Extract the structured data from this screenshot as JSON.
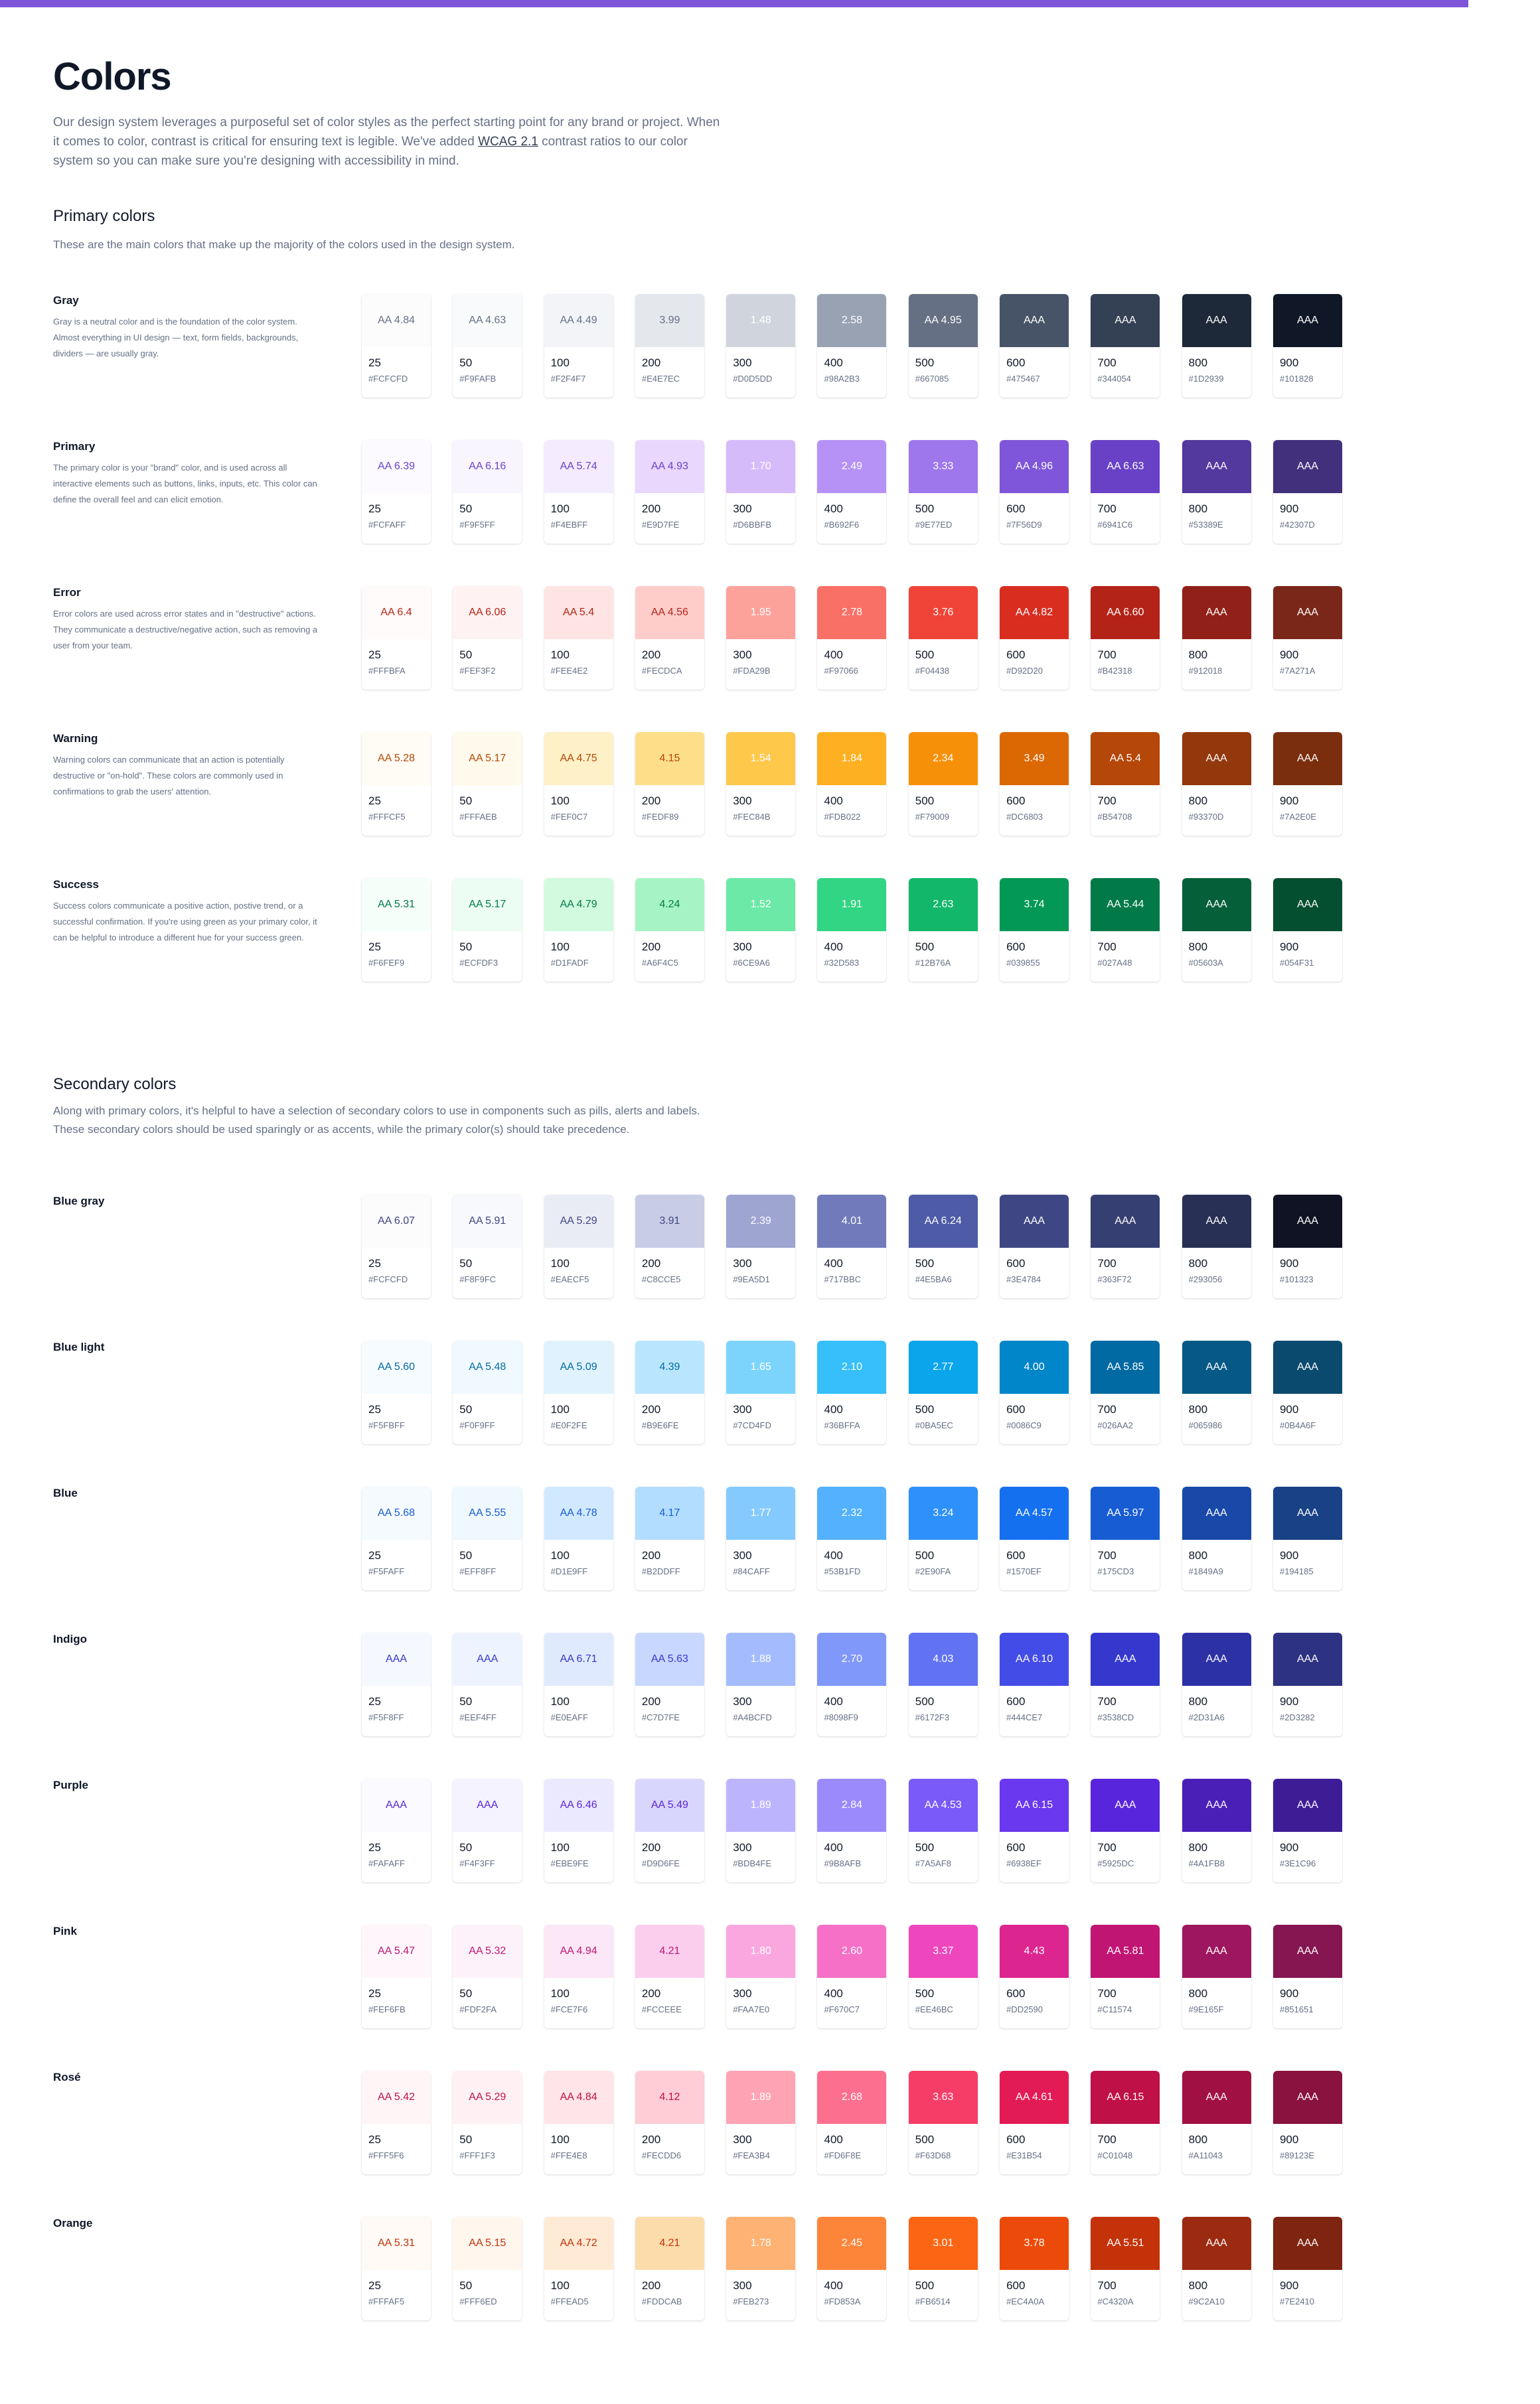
{
  "accent": "#7F56D9",
  "title": "Colors",
  "intro": {
    "text_before": "Our design system leverages a purposeful set of color styles as the perfect starting point for any brand or project. When it comes to color, contrast is critical for ensuring text is legible. We've added ",
    "link": "WCAG 2.1",
    "text_after": " contrast ratios to our color system so you can make sure you're designing with accessibility in mind."
  },
  "primary_section": {
    "title": "Primary colors",
    "description": "These are the main colors that make up the majority of the colors used in the design system."
  },
  "secondary_section": {
    "title": "Secondary colors",
    "description": "Along with primary colors, it's helpful to have a selection of secondary colors to use in components such as pills, alerts and labels. These secondary colors should be used sparingly or as accents, while the primary color(s) should take precedence."
  },
  "steps": [
    "25",
    "50",
    "100",
    "200",
    "300",
    "400",
    "500",
    "600",
    "700",
    "800",
    "900"
  ],
  "primary_palettes": [
    {
      "name": "Gray",
      "description": "Gray is a neutral color and is the foundation of the color system. Almost everything in UI design — text, form fields, backgrounds, dividers — are usually gray.",
      "hex": [
        "#FCFCFD",
        "#F9FAFB",
        "#F2F4F7",
        "#E4E7EC",
        "#D0D5DD",
        "#98A2B3",
        "#667085",
        "#475467",
        "#344054",
        "#1D2939",
        "#101828"
      ],
      "contrast": [
        "AA 4.84",
        "AA 4.63",
        "AA 4.49",
        "3.99",
        "1.48",
        "2.58",
        "AA 4.95",
        "AAA",
        "AAA",
        "AAA",
        "AAA"
      ],
      "label_color": [
        "#667085",
        "#667085",
        "#667085",
        "#667085",
        "#FFFFFF",
        "#FFFFFF",
        "#FFFFFF",
        "#FFFFFF",
        "#FFFFFF",
        "#FFFFFF",
        "#FFFFFF"
      ]
    },
    {
      "name": "Primary",
      "description": "The primary color is your \"brand\" color, and is used across all interactive elements such as buttons, links, inputs, etc. This color can define the overall feel and can elicit emotion.",
      "hex": [
        "#FCFAFF",
        "#F9F5FF",
        "#F4EBFF",
        "#E9D7FE",
        "#D6BBFB",
        "#B692F6",
        "#9E77ED",
        "#7F56D9",
        "#6941C6",
        "#53389E",
        "#42307D"
      ],
      "contrast": [
        "AA 6.39",
        "AA 6.16",
        "AA 5.74",
        "AA 4.93",
        "1.70",
        "2.49",
        "3.33",
        "AA 4.96",
        "AA 6.63",
        "AAA",
        "AAA"
      ],
      "label_color": [
        "#6941C6",
        "#6941C6",
        "#6941C6",
        "#6941C6",
        "#FFFFFF",
        "#FFFFFF",
        "#FFFFFF",
        "#FFFFFF",
        "#FFFFFF",
        "#FFFFFF",
        "#FFFFFF"
      ]
    },
    {
      "name": "Error",
      "description": "Error colors are used across error states and in \"destructive\" actions. They communicate a destructive/negative action, such as removing a user from your team.",
      "hex": [
        "#FFFBFA",
        "#FEF3F2",
        "#FEE4E2",
        "#FECDCA",
        "#FDA29B",
        "#F97066",
        "#F04438",
        "#D92D20",
        "#B42318",
        "#912018",
        "#7A271A"
      ],
      "contrast": [
        "AA 6.4",
        "AA 6.06",
        "AA 5.4",
        "AA 4.56",
        "1.95",
        "2.78",
        "3.76",
        "AA 4.82",
        "AA 6.60",
        "AAA",
        "AAA"
      ],
      "label_color": [
        "#B42318",
        "#B42318",
        "#B42318",
        "#B42318",
        "#FFFFFF",
        "#FFFFFF",
        "#FFFFFF",
        "#FFFFFF",
        "#FFFFFF",
        "#FFFFFF",
        "#FFFFFF"
      ]
    },
    {
      "name": "Warning",
      "description": "Warning colors can communicate that an action is potentially destructive or \"on-hold\". These colors are commonly used in confirmations to grab the users' attention.",
      "hex": [
        "#FFFCF5",
        "#FFFAEB",
        "#FEF0C7",
        "#FEDF89",
        "#FEC84B",
        "#FDB022",
        "#F79009",
        "#DC6803",
        "#B54708",
        "#93370D",
        "#7A2E0E"
      ],
      "contrast": [
        "AA 5.28",
        "AA 5.17",
        "AA 4.75",
        "4.15",
        "1.54",
        "1.84",
        "2.34",
        "3.49",
        "AA 5.4",
        "AAA",
        "AAA"
      ],
      "label_color": [
        "#B54708",
        "#B54708",
        "#B54708",
        "#B54708",
        "#FFFFFF",
        "#FFFFFF",
        "#FFFFFF",
        "#FFFFFF",
        "#FFFFFF",
        "#FFFFFF",
        "#FFFFFF"
      ]
    },
    {
      "name": "Success",
      "description": "Success colors communicate a positive action, postive trend, or a successful confirmation. If you're using green as your primary color, it can be helpful to introduce a different hue for your success green.",
      "hex": [
        "#F6FEF9",
        "#ECFDF3",
        "#D1FADF",
        "#A6F4C5",
        "#6CE9A6",
        "#32D583",
        "#12B76A",
        "#039855",
        "#027A48",
        "#05603A",
        "#054F31"
      ],
      "contrast": [
        "AA 5.31",
        "AA 5.17",
        "AA 4.79",
        "4.24",
        "1.52",
        "1.91",
        "2.63",
        "3.74",
        "AA 5.44",
        "AAA",
        "AAA"
      ],
      "label_color": [
        "#027A48",
        "#027A48",
        "#027A48",
        "#027A48",
        "#FFFFFF",
        "#FFFFFF",
        "#FFFFFF",
        "#FFFFFF",
        "#FFFFFF",
        "#FFFFFF",
        "#FFFFFF"
      ]
    }
  ],
  "secondary_palettes": [
    {
      "name": "Blue gray",
      "description": "",
      "hex": [
        "#FCFCFD",
        "#F8F9FC",
        "#EAECF5",
        "#C8CCE5",
        "#9EA5D1",
        "#717BBC",
        "#4E5BA6",
        "#3E4784",
        "#363F72",
        "#293056",
        "#101323"
      ],
      "contrast": [
        "AA 6.07",
        "AA 5.91",
        "AA 5.29",
        "3.91",
        "2.39",
        "4.01",
        "AA 6.24",
        "AAA",
        "AAA",
        "AAA",
        "AAA"
      ],
      "label_color": [
        "#3E4784",
        "#3E4784",
        "#3E4784",
        "#3E4784",
        "#FFFFFF",
        "#FFFFFF",
        "#FFFFFF",
        "#FFFFFF",
        "#FFFFFF",
        "#FFFFFF",
        "#FFFFFF"
      ]
    },
    {
      "name": "Blue light",
      "description": "",
      "hex": [
        "#F5FBFF",
        "#F0F9FF",
        "#E0F2FE",
        "#B9E6FE",
        "#7CD4FD",
        "#36BFFA",
        "#0BA5EC",
        "#0086C9",
        "#026AA2",
        "#065986",
        "#0B4A6F"
      ],
      "contrast": [
        "AA 5.60",
        "AA 5.48",
        "AA 5.09",
        "4.39",
        "1.65",
        "2.10",
        "2.77",
        "4.00",
        "AA 5.85",
        "AAA",
        "AAA"
      ],
      "label_color": [
        "#026AA2",
        "#026AA2",
        "#026AA2",
        "#026AA2",
        "#FFFFFF",
        "#FFFFFF",
        "#FFFFFF",
        "#FFFFFF",
        "#FFFFFF",
        "#FFFFFF",
        "#FFFFFF"
      ]
    },
    {
      "name": "Blue",
      "description": "",
      "hex": [
        "#F5FAFF",
        "#EFF8FF",
        "#D1E9FF",
        "#B2DDFF",
        "#84CAFF",
        "#53B1FD",
        "#2E90FA",
        "#1570EF",
        "#175CD3",
        "#1849A9",
        "#194185"
      ],
      "contrast": [
        "AA 5.68",
        "AA 5.55",
        "AA 4.78",
        "4.17",
        "1.77",
        "2.32",
        "3.24",
        "AA 4.57",
        "AA 5.97",
        "AAA",
        "AAA"
      ],
      "label_color": [
        "#175CD3",
        "#175CD3",
        "#175CD3",
        "#175CD3",
        "#FFFFFF",
        "#FFFFFF",
        "#FFFFFF",
        "#FFFFFF",
        "#FFFFFF",
        "#FFFFFF",
        "#FFFFFF"
      ]
    },
    {
      "name": "Indigo",
      "description": "",
      "hex": [
        "#F5F8FF",
        "#EEF4FF",
        "#E0EAFF",
        "#C7D7FE",
        "#A4BCFD",
        "#8098F9",
        "#6172F3",
        "#444CE7",
        "#3538CD",
        "#2D31A6",
        "#2D3282"
      ],
      "contrast": [
        "AAA",
        "AAA",
        "AA 6.71",
        "AA 5.63",
        "1.88",
        "2.70",
        "4.03",
        "AA 6.10",
        "AAA",
        "AAA",
        "AAA"
      ],
      "label_color": [
        "#3538CD",
        "#3538CD",
        "#3538CD",
        "#3538CD",
        "#FFFFFF",
        "#FFFFFF",
        "#FFFFFF",
        "#FFFFFF",
        "#FFFFFF",
        "#FFFFFF",
        "#FFFFFF"
      ]
    },
    {
      "name": "Purple",
      "description": "",
      "hex": [
        "#FAFAFF",
        "#F4F3FF",
        "#EBE9FE",
        "#D9D6FE",
        "#BDB4FE",
        "#9B8AFB",
        "#7A5AF8",
        "#6938EF",
        "#5925DC",
        "#4A1FB8",
        "#3E1C96"
      ],
      "contrast": [
        "AAA",
        "AAA",
        "AA 6.46",
        "AA 5.49",
        "1.89",
        "2.84",
        "AA 4.53",
        "AA 6.15",
        "AAA",
        "AAA",
        "AAA"
      ],
      "label_color": [
        "#5925DC",
        "#5925DC",
        "#5925DC",
        "#5925DC",
        "#FFFFFF",
        "#FFFFFF",
        "#FFFFFF",
        "#FFFFFF",
        "#FFFFFF",
        "#FFFFFF",
        "#FFFFFF"
      ]
    },
    {
      "name": "Pink",
      "description": "",
      "hex": [
        "#FEF6FB",
        "#FDF2FA",
        "#FCE7F6",
        "#FCCEEE",
        "#FAA7E0",
        "#F670C7",
        "#EE46BC",
        "#DD2590",
        "#C11574",
        "#9E165F",
        "#851651"
      ],
      "contrast": [
        "AA 5.47",
        "AA 5.32",
        "AA 4.94",
        "4.21",
        "1.80",
        "2.60",
        "3.37",
        "4.43",
        "AA 5.81",
        "AAA",
        "AAA"
      ],
      "label_color": [
        "#C11574",
        "#C11574",
        "#C11574",
        "#C11574",
        "#FFFFFF",
        "#FFFFFF",
        "#FFFFFF",
        "#FFFFFF",
        "#FFFFFF",
        "#FFFFFF",
        "#FFFFFF"
      ]
    },
    {
      "name": "Rosé",
      "description": "",
      "hex": [
        "#FFF5F6",
        "#FFF1F3",
        "#FFE4E8",
        "#FECDD6",
        "#FEA3B4",
        "#FD6F8E",
        "#F63D68",
        "#E31B54",
        "#C01048",
        "#A11043",
        "#89123E"
      ],
      "contrast": [
        "AA 5.42",
        "AA 5.29",
        "AA 4.84",
        "4.12",
        "1.89",
        "2.68",
        "3.63",
        "AA 4.61",
        "AA 6.15",
        "AAA",
        "AAA"
      ],
      "label_color": [
        "#C01048",
        "#C01048",
        "#C01048",
        "#C01048",
        "#FFFFFF",
        "#FFFFFF",
        "#FFFFFF",
        "#FFFFFF",
        "#FFFFFF",
        "#FFFFFF",
        "#FFFFFF"
      ]
    },
    {
      "name": "Orange",
      "description": "",
      "hex": [
        "#FFFAF5",
        "#FFF6ED",
        "#FFEAD5",
        "#FDDCAB",
        "#FEB273",
        "#FD853A",
        "#FB6514",
        "#EC4A0A",
        "#C4320A",
        "#9C2A10",
        "#7E2410"
      ],
      "contrast": [
        "AA 5.31",
        "AA 5.15",
        "AA 4.72",
        "4.21",
        "1.78",
        "2.45",
        "3.01",
        "3.78",
        "AA 5.51",
        "AAA",
        "AAA"
      ],
      "label_color": [
        "#C4320A",
        "#C4320A",
        "#C4320A",
        "#C4320A",
        "#FFFFFF",
        "#FFFFFF",
        "#FFFFFF",
        "#FFFFFF",
        "#FFFFFF",
        "#FFFFFF",
        "#FFFFFF"
      ]
    }
  ]
}
